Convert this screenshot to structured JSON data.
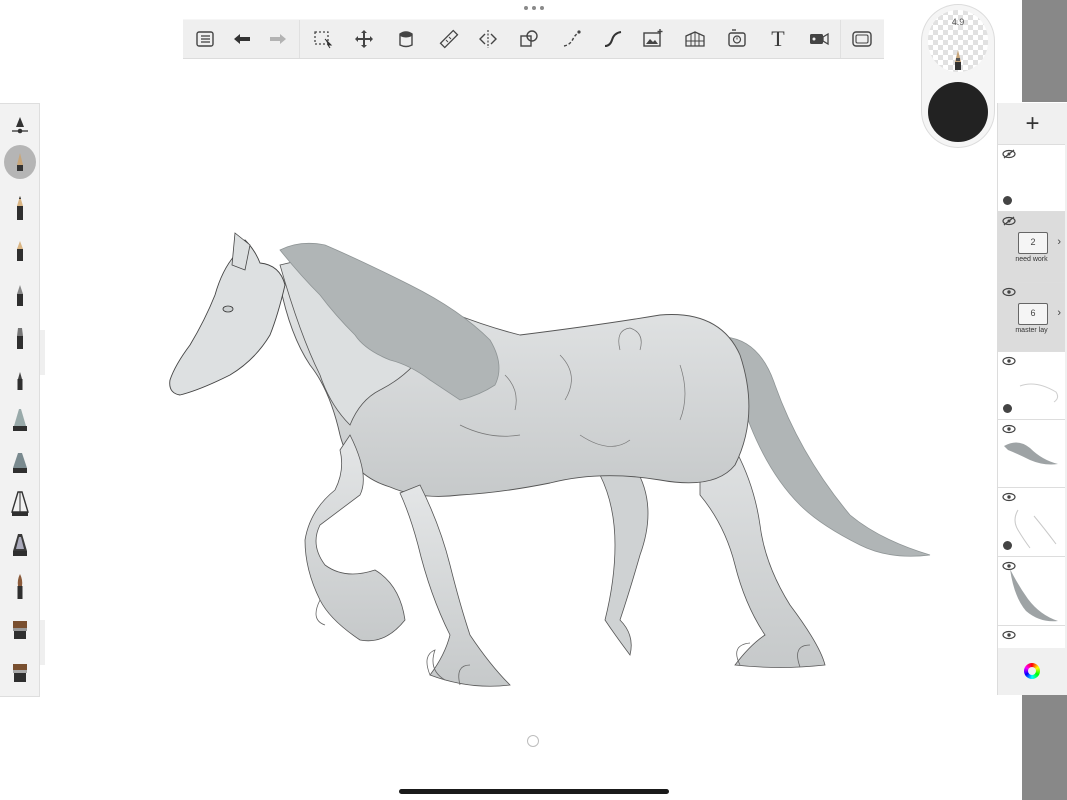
{
  "app": {
    "brush_size": "4.9",
    "current_color": "#222222"
  },
  "toolbar": {
    "tools": [
      "list-icon",
      "undo-icon",
      "redo-icon",
      "selection-icon",
      "transform-icon",
      "fill-icon",
      "ruler-icon",
      "symmetry-icon",
      "shapes-icon",
      "stroke-icon",
      "curve-icon",
      "image-import-icon",
      "perspective-icon",
      "time-lapse-icon",
      "text-tool",
      "video-icon",
      "fullscreen-icon"
    ],
    "text_tool_label": "T"
  },
  "layers": {
    "add_label": "+",
    "groups": [
      {
        "name": "need work",
        "count": "2"
      },
      {
        "name": "master lay",
        "count": "6"
      }
    ]
  },
  "colors": {
    "toolbar_bg": "#efefef",
    "panel_bg": "#f0f0f0",
    "side_strip": "#888888",
    "horse_body": "#d9dcdd",
    "mane_tail": "#b0b5b6"
  }
}
